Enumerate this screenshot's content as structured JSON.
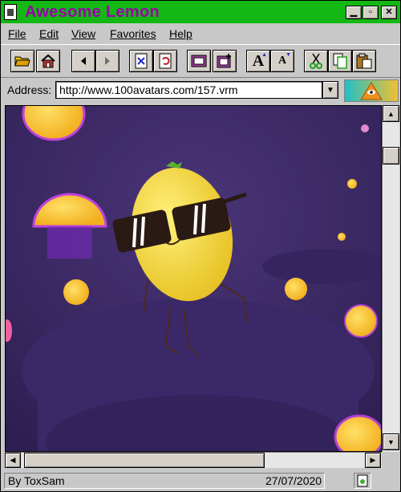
{
  "window": {
    "title": "Awesome Lemon",
    "controls": {
      "minimize": "▁",
      "maximize": "▫",
      "close": "✕"
    }
  },
  "menu": [
    "File",
    "Edit",
    "View",
    "Favorites",
    "Help"
  ],
  "toolbar": {
    "buttons": [
      "open-folder-icon",
      "home-icon",
      "back-icon",
      "forward-icon",
      "stop-icon",
      "refresh-icon",
      "image-icon",
      "add-image-icon",
      "increase-font-icon",
      "decrease-font-icon",
      "cut-icon",
      "copy-icon",
      "paste-icon"
    ],
    "font_large": "A",
    "font_small": "A"
  },
  "address": {
    "label": "Address:",
    "url": "http://www.100avatars.com/157.vrm"
  },
  "status": {
    "author": "By ToxSam",
    "date": "27/07/2020"
  },
  "colors": {
    "titlebar": "#14b814",
    "title_text": "#9b00a8",
    "chrome": "#c8c8c8",
    "scene_bg": "#3e2a66",
    "lemon": "#f2d43a"
  }
}
